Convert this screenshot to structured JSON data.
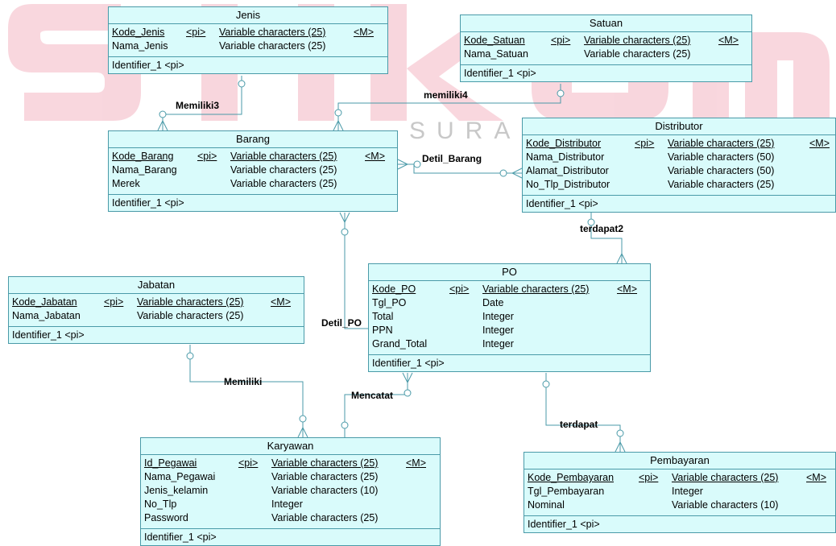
{
  "watermark": {
    "logo": "stikom",
    "subtitle": "SURABAYA",
    "color": "#f4b6c2"
  },
  "colors": {
    "entity_fill": "#d9fbfb",
    "entity_border": "#4a9aa8",
    "line": "#4a9aa8"
  },
  "entities": {
    "jenis": {
      "title": "Jenis",
      "attributes": [
        {
          "name": "Kode_Jenis",
          "key": "<pi>",
          "type": "Variable characters (25)",
          "mandatory": "<M>"
        },
        {
          "name": "Nama_Jenis",
          "key": "",
          "type": "Variable characters (25)",
          "mandatory": ""
        }
      ],
      "identifier": "Identifier_1  <pi>"
    },
    "satuan": {
      "title": "Satuan",
      "attributes": [
        {
          "name": "Kode_Satuan",
          "key": "<pi>",
          "type": "Variable characters (25)",
          "mandatory": "<M>"
        },
        {
          "name": "Nama_Satuan",
          "key": "",
          "type": "Variable characters (25)",
          "mandatory": ""
        }
      ],
      "identifier": "Identifier_1  <pi>"
    },
    "barang": {
      "title": "Barang",
      "attributes": [
        {
          "name": "Kode_Barang",
          "key": "<pi>",
          "type": "Variable characters (25)",
          "mandatory": "<M>"
        },
        {
          "name": "Nama_Barang",
          "key": "",
          "type": "Variable characters (25)",
          "mandatory": ""
        },
        {
          "name": "Merek",
          "key": "",
          "type": "Variable characters (25)",
          "mandatory": ""
        }
      ],
      "identifier": "Identifier_1  <pi>"
    },
    "distributor": {
      "title": "Distributor",
      "attributes": [
        {
          "name": "Kode_Distributor",
          "key": "<pi>",
          "type": "Variable characters (25)",
          "mandatory": "<M>"
        },
        {
          "name": "Nama_Distributor",
          "key": "",
          "type": "Variable characters (50)",
          "mandatory": ""
        },
        {
          "name": "Alamat_Distributor",
          "key": "",
          "type": "Variable characters (50)",
          "mandatory": ""
        },
        {
          "name": "No_Tlp_Distributor",
          "key": "",
          "type": "Variable characters (25)",
          "mandatory": ""
        }
      ],
      "identifier": "Identifier_1  <pi>"
    },
    "po": {
      "title": "PO",
      "attributes": [
        {
          "name": "Kode_PO",
          "key": "<pi>",
          "type": "Variable characters (25)",
          "mandatory": "<M>"
        },
        {
          "name": "Tgl_PO",
          "key": "",
          "type": "Date",
          "mandatory": ""
        },
        {
          "name": "Total",
          "key": "",
          "type": "Integer",
          "mandatory": ""
        },
        {
          "name": "PPN",
          "key": "",
          "type": "Integer",
          "mandatory": ""
        },
        {
          "name": "Grand_Total",
          "key": "",
          "type": "Integer",
          "mandatory": ""
        }
      ],
      "identifier": "Identifier_1  <pi>"
    },
    "jabatan": {
      "title": "Jabatan",
      "attributes": [
        {
          "name": "Kode_Jabatan",
          "key": "<pi>",
          "type": "Variable characters (25)",
          "mandatory": "<M>"
        },
        {
          "name": "Nama_Jabatan",
          "key": "",
          "type": "Variable characters (25)",
          "mandatory": ""
        }
      ],
      "identifier": "Identifier_1  <pi>"
    },
    "karyawan": {
      "title": "Karyawan",
      "attributes": [
        {
          "name": "Id_Pegawai",
          "key": "<pi>",
          "type": "Variable characters (25)",
          "mandatory": "<M>"
        },
        {
          "name": "Nama_Pegawai",
          "key": "",
          "type": "Variable characters (25)",
          "mandatory": ""
        },
        {
          "name": "Jenis_kelamin",
          "key": "",
          "type": "Variable characters (10)",
          "mandatory": ""
        },
        {
          "name": "No_Tlp",
          "key": "",
          "type": "Integer",
          "mandatory": ""
        },
        {
          "name": "Password",
          "key": "",
          "type": "Variable characters (25)",
          "mandatory": ""
        }
      ],
      "identifier": "Identifier_1  <pi>"
    },
    "pembayaran": {
      "title": "Pembayaran",
      "attributes": [
        {
          "name": "Kode_Pembayaran",
          "key": "<pi>",
          "type": "Variable characters (25)",
          "mandatory": "<M>"
        },
        {
          "name": "Tgl_Pembayaran",
          "key": "",
          "type": "Integer",
          "mandatory": ""
        },
        {
          "name": "Nominal",
          "key": "",
          "type": "Variable characters (10)",
          "mandatory": ""
        }
      ],
      "identifier": "Identifier_1  <pi>"
    }
  },
  "relationships": {
    "memiliki3": "Memiliki3",
    "memiliki4": "memiliki4",
    "detil_barang": "Detil_Barang",
    "terdapat2": "terdapat2",
    "detil_po": "Detil_PO",
    "memiliki": "Memiliki",
    "mencatat": "Mencatat",
    "terdapat": "terdapat"
  }
}
